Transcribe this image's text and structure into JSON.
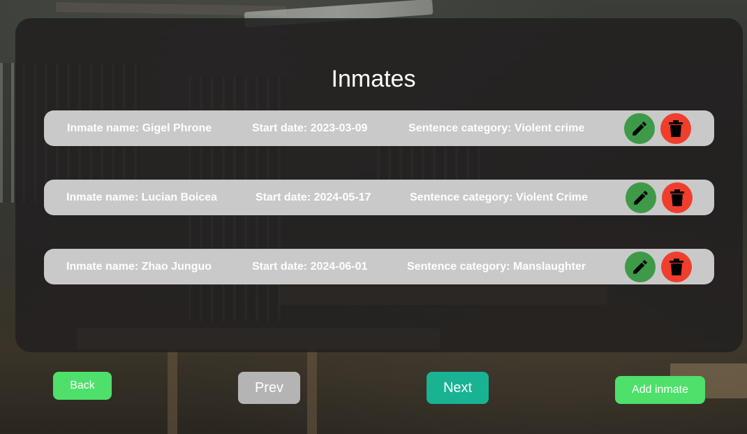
{
  "page": {
    "title": "Inmates"
  },
  "inmates": [
    {
      "name_text": "Inmate name: Gigel Phrone",
      "start_text": "Start date: 2023-03-09",
      "category_text": "Sentence category: Violent crime"
    },
    {
      "name_text": "Inmate name: Lucian Boicea",
      "start_text": "Start date: 2024-05-17",
      "category_text": "Sentence category: Violent Crime"
    },
    {
      "name_text": "Inmate name: Zhao Junguo",
      "start_text": "Start date: 2024-06-01",
      "category_text": "Sentence category: Manslaughter"
    }
  ],
  "row_actions": {
    "edit_icon": "pencil-icon",
    "delete_icon": "trash-icon"
  },
  "footer": {
    "back_label": "Back",
    "prev_label": "Prev",
    "next_label": "Next",
    "add_label": "Add inmate"
  },
  "colors": {
    "edit": "#3e9a48",
    "delete": "#f03e2c",
    "back": "#4ee06a",
    "prev": "#b4b4b4",
    "next": "#19b394",
    "add": "#4ee06a",
    "row": "#c9c9c9"
  }
}
